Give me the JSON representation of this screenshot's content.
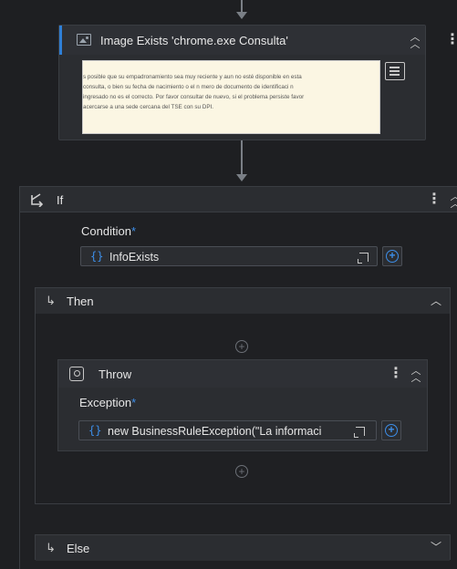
{
  "image_exists": {
    "title": "Image Exists 'chrome.exe Consulta'",
    "preview_lines": [
      "s posible que su empadronamiento sea muy reciente y aun no esté disponible en esta",
      "consulta, o bien su fecha de nacimiento o el n mero de documento de identificaci n",
      "ingresado no es el correcto. Por favor consultar de nuevo, si el problema persiste favor",
      "acercarse a una sede cercana del TSE con su DPI."
    ]
  },
  "if_activity": {
    "title": "If",
    "condition_label": "Condition",
    "required_mark": "*",
    "condition_value": "InfoExists"
  },
  "then": {
    "title": "Then",
    "throw": {
      "title": "Throw",
      "exception_label": "Exception",
      "required_mark": "*",
      "exception_value": "new BusinessRuleException(\"La informaci"
    }
  },
  "else": {
    "title": "Else"
  },
  "colors": {
    "accent": "#3d8ee8",
    "background": "#1e1f22",
    "card": "#2b2d31"
  }
}
